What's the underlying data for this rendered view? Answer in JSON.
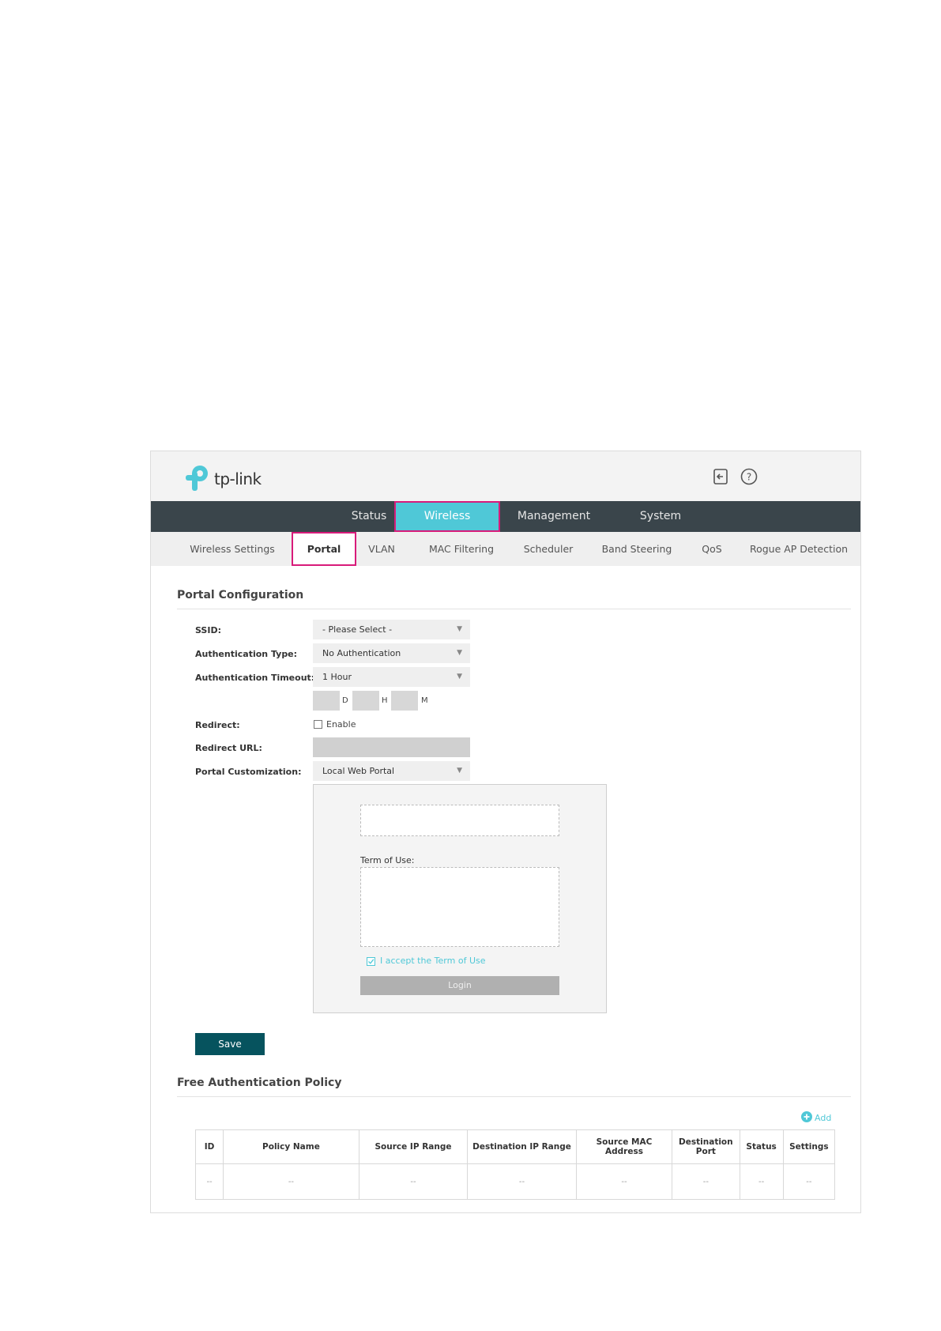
{
  "logo": {
    "text": "tp-link"
  },
  "main_nav": [
    {
      "label": "Status"
    },
    {
      "label": "Wireless"
    },
    {
      "label": "Management"
    },
    {
      "label": "System"
    }
  ],
  "sub_nav": [
    {
      "label": "Wireless Settings"
    },
    {
      "label": "Portal"
    },
    {
      "label": "VLAN"
    },
    {
      "label": "MAC Filtering"
    },
    {
      "label": "Scheduler"
    },
    {
      "label": "Band Steering"
    },
    {
      "label": "QoS"
    },
    {
      "label": "Rogue AP Detection"
    }
  ],
  "portal": {
    "title": "Portal Configuration",
    "ssid_label": "SSID:",
    "ssid_value": "- Please Select -",
    "auth_type_label": "Authentication Type:",
    "auth_type_value": "No Authentication",
    "auth_timeout_label": "Authentication Timeout:",
    "auth_timeout_value": "1 Hour",
    "unit_d": "D",
    "unit_h": "H",
    "unit_m": "M",
    "redirect_label": "Redirect:",
    "redirect_enable": "Enable",
    "redirect_url_label": "Redirect URL:",
    "customization_label": "Portal Customization:",
    "customization_value": "Local Web Portal",
    "term_of_use_label": "Term of Use:",
    "accept_text": "I accept the Term of Use",
    "login_label": "Login",
    "save_label": "Save"
  },
  "policy": {
    "title": "Free Authentication Policy",
    "add_label": "Add",
    "columns": [
      "ID",
      "Policy Name",
      "Source IP Range",
      "Destination IP Range",
      "Source MAC Address",
      "Destination Port",
      "Status",
      "Settings"
    ],
    "row": [
      "--",
      "--",
      "--",
      "--",
      "--",
      "--",
      "--",
      "--"
    ]
  },
  "colors": {
    "accent": "#4fc8d7",
    "highlight": "#d81b7a",
    "nav_bg": "#3a454b",
    "save_bg": "#06535e"
  },
  "icons": [
    "tp-link-logo-icon",
    "logout-icon",
    "help-icon",
    "add-icon",
    "dropdown-arrow-icon",
    "checkbox-icon"
  ]
}
